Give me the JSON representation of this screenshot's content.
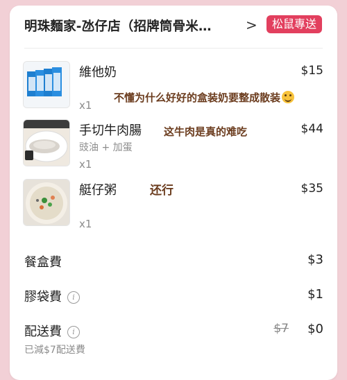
{
  "header": {
    "store_name": "明珠麵家-氹仔店（招牌筒骨米…",
    "chevron": ">",
    "badge_label": "松鼠專送"
  },
  "items": [
    {
      "name": "維他奶",
      "option": "",
      "qty": "x1",
      "price": "$15",
      "note": "不懂为什么好好的盒装奶要整成散装",
      "image_icon": "vita-soy-milk-image"
    },
    {
      "name": "手切牛肉腸",
      "option": "豉油 + 加蛋",
      "qty": "x1",
      "price": "$44",
      "note": "这牛肉是真的难吃",
      "image_icon": "beef-rice-roll-image"
    },
    {
      "name": "艇仔粥",
      "option": "",
      "qty": "x1",
      "price": "$35",
      "note": "还行",
      "image_icon": "congee-image"
    }
  ],
  "fees": {
    "box_fee_label": "餐盒費",
    "box_fee_value": "$3",
    "bag_fee_label": "膠袋費",
    "bag_fee_value": "$1",
    "delivery_fee_label": "配送費",
    "delivery_fee_original": "$7",
    "delivery_fee_value": "$0",
    "delivery_discount_note": "已減$7配送費"
  },
  "colors": {
    "badge": "#e23f5e",
    "note_text": "#6b3c1e",
    "page_bg": "#f2d0d6"
  }
}
